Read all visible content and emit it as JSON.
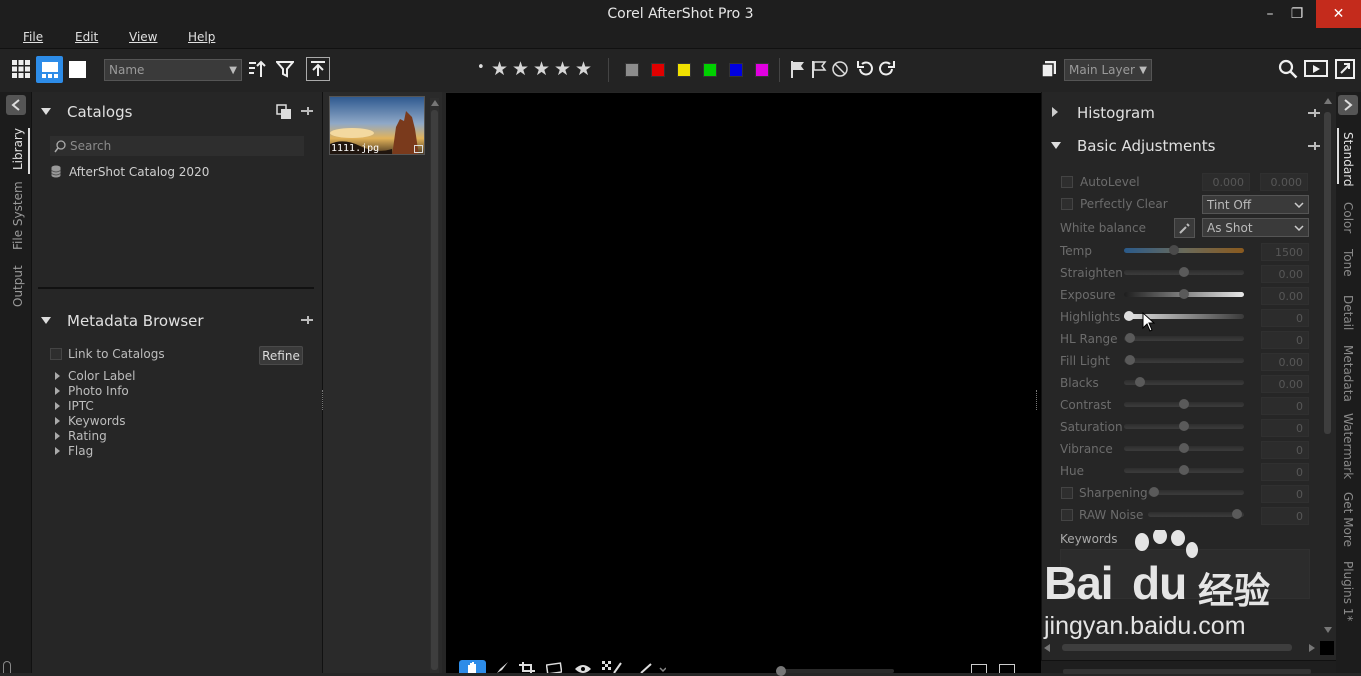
{
  "window": {
    "title": "Corel AfterShot Pro 3",
    "minimize": "–",
    "restore": "❐",
    "close": "✕"
  },
  "menu": [
    "File",
    "Edit",
    "View",
    "Help"
  ],
  "toolbar": {
    "sort_select": "Name",
    "stars_dot": "•",
    "star_glyph": "★",
    "swatches": [
      "#8c8c8c",
      "#e00000",
      "#f0e000",
      "#00d000",
      "#0000e0",
      "#e000e0"
    ],
    "layer_select": "Main Layer"
  },
  "left_tabs": [
    "Library",
    "File System",
    "Output"
  ],
  "catalogs": {
    "title": "Catalogs",
    "search_placeholder": "Search",
    "items": [
      "AfterShot Catalog 2020"
    ]
  },
  "metadata_browser": {
    "title": "Metadata Browser",
    "link_label": "Link to Catalogs",
    "refine_button": "Refine",
    "items": [
      "Color Label",
      "Photo Info",
      "IPTC",
      "Keywords",
      "Rating",
      "Flag"
    ]
  },
  "filmstrip": {
    "thumb_label": "1111.jpg"
  },
  "histogram": {
    "title": "Histogram"
  },
  "basic_adjustments": {
    "title": "Basic Adjustments",
    "autolevel": {
      "label": "AutoLevel",
      "v1": "0.000",
      "v2": "0.000"
    },
    "perfectly_clear": {
      "label": "Perfectly Clear",
      "value": "Tint Off"
    },
    "white_balance": {
      "label": "White balance",
      "value": "As Shot"
    },
    "sliders": [
      {
        "label": "Temp",
        "value": "1500"
      },
      {
        "label": "Straighten",
        "value": "0.00"
      },
      {
        "label": "Exposure",
        "value": "0.00"
      },
      {
        "label": "Highlights",
        "value": "0"
      },
      {
        "label": "HL Range",
        "value": "0"
      },
      {
        "label": "Fill Light",
        "value": "0.00"
      },
      {
        "label": "Blacks",
        "value": "0.00"
      },
      {
        "label": "Contrast",
        "value": "0"
      },
      {
        "label": "Saturation",
        "value": "0"
      },
      {
        "label": "Vibrance",
        "value": "0"
      },
      {
        "label": "Hue",
        "value": "0"
      },
      {
        "label": "Sharpening",
        "value": "0"
      },
      {
        "label": "RAW Noise",
        "value": "0"
      }
    ],
    "keywords_label": "Keywords"
  },
  "right_tabs": [
    "Standard",
    "Color",
    "Tone",
    "Detail",
    "Metadata",
    "Watermark",
    "Get More",
    "Plugins 1*"
  ],
  "watermark": {
    "brand": "Bai",
    "brand2": "du",
    "cn": "经验",
    "url": "jingyan.baidu.com"
  }
}
